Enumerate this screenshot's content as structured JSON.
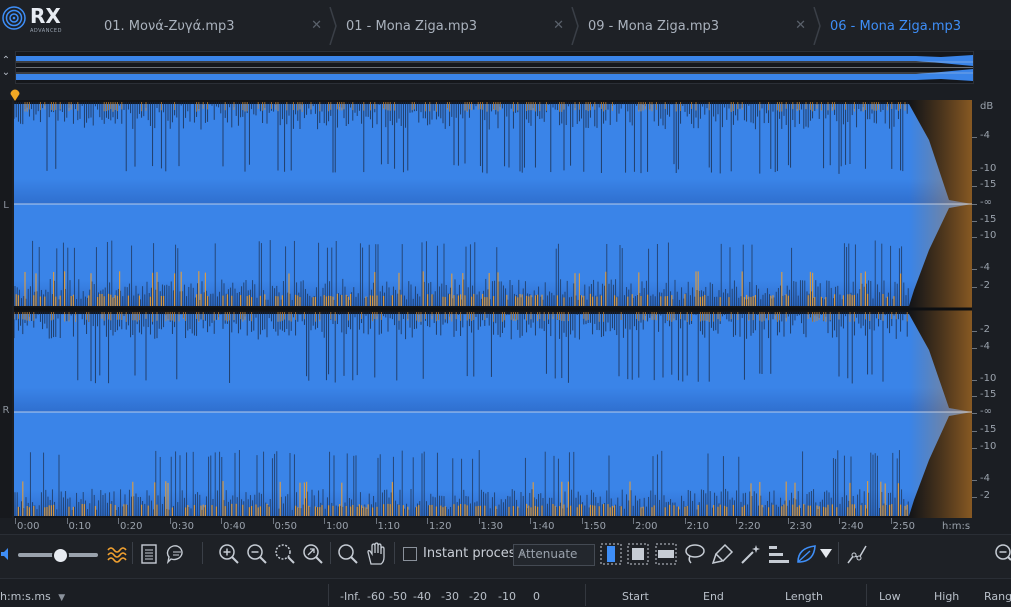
{
  "app": {
    "logo_text": "RX",
    "logo_subtext": "ADVANCED"
  },
  "tabs": [
    {
      "label": "01. Μονά-Ζυγά.mp3",
      "active": false
    },
    {
      "label": "01 - Mona Ziga.mp3",
      "active": false
    },
    {
      "label": "09 - Mona Ziga.mp3",
      "active": false
    },
    {
      "label": "06 - Mona Ziga.mp3",
      "active": true
    }
  ],
  "channels": {
    "left": "L",
    "right": "R"
  },
  "db_scale": {
    "unit": "dB",
    "upper_labels": [
      "-4",
      "-10",
      "-15",
      "-∞",
      "-15",
      "-10",
      "-4",
      "-2"
    ],
    "lower_labels": [
      "-2",
      "-4",
      "-10",
      "-15",
      "-∞",
      "-15",
      "-10",
      "-4",
      "-2"
    ]
  },
  "time_ruler": {
    "labels": [
      "0:00",
      "0:10",
      "0:20",
      "0:30",
      "0:40",
      "0:50",
      "1:00",
      "1:10",
      "1:20",
      "1:30",
      "1:40",
      "1:50",
      "2:00",
      "2:10",
      "2:20",
      "2:30",
      "2:40",
      "2:50"
    ],
    "unit": "h:m:s"
  },
  "toolbar": {
    "instant_process_label": "Instant process",
    "instant_process_checked": false,
    "mode_value": "Attenuate"
  },
  "status_bar": {
    "time_format": "h:m:s.ms",
    "meter_labels": [
      "-Inf.",
      "-60",
      "-50",
      "-40",
      "-30",
      "-20",
      "-10",
      "0"
    ],
    "columns": [
      "Start",
      "End",
      "Length",
      "Low",
      "High",
      "Range"
    ]
  },
  "colors": {
    "accent": "#3e8ef7",
    "waveform": "#3a84e8",
    "spectrogram_hot": "#f0a030"
  }
}
